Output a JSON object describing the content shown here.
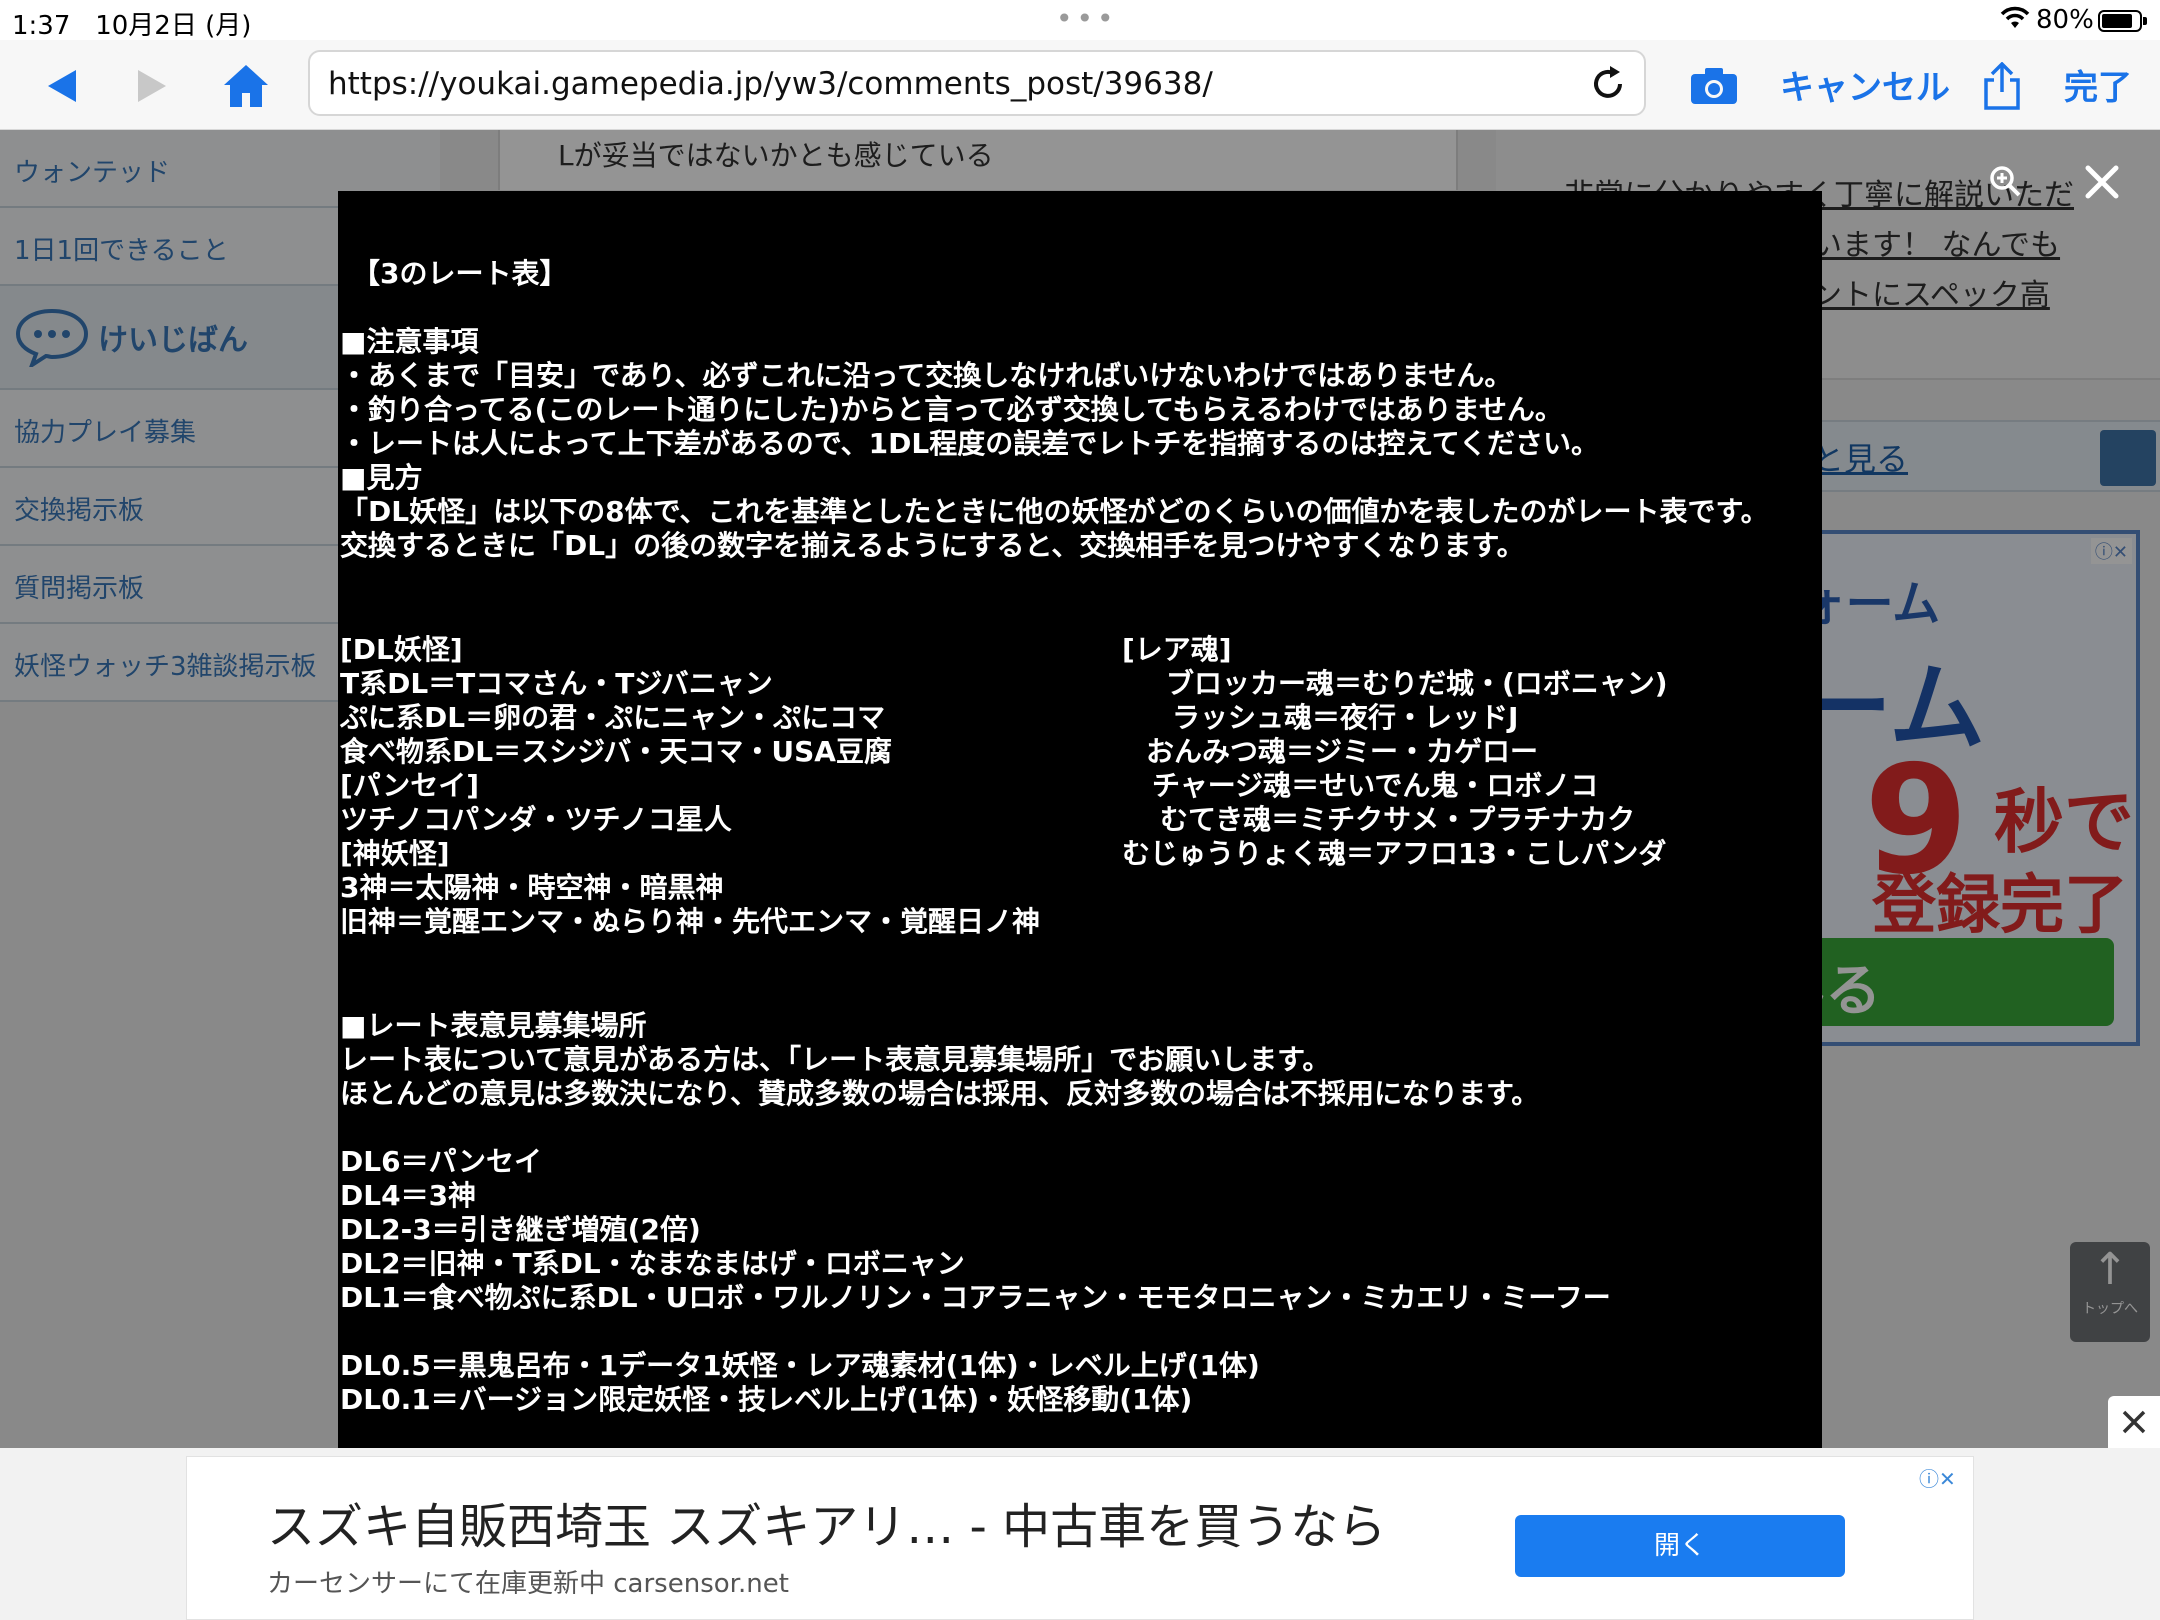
{
  "status_bar": {
    "time": "1:37",
    "date": "10月2日 (月)",
    "battery": "80%",
    "dots": "•••"
  },
  "toolbar": {
    "url": "https://youkai.gamepedia.jp/yw3/comments_post/39638/",
    "cancel_label": "キャンセル",
    "done_label": "完了"
  },
  "sidebar": {
    "items": [
      "ウォンテッド",
      "1日1回できること",
      "けいじばん",
      "協力プレイ募集",
      "交換掲示板",
      "質問掲示板",
      "妖怪ウォッチ3雑談掲示板"
    ]
  },
  "main": {
    "snippet": "Lが妥当ではないかとも感じている"
  },
  "right_panel": {
    "lines": [
      "非常に分かりやすく丁寧に解説いただ",
      "います！ なんでも",
      "ントにスペック高"
    ],
    "more_link": "と見る"
  },
  "side_ad": {
    "line1": "るSSLフォーム",
    "line2": "フォーム",
    "big_num": "9",
    "line3": "秒で",
    "line4": "登録完了!",
    "button": "使ってみる",
    "badge": "ⓘ✕"
  },
  "to_top": {
    "label": "トップへ"
  },
  "lightbox": {
    "title": "【3のレート表】",
    "notes_header": "■注意事項",
    "notes": [
      "・あくまで「目安」であり、必ずこれに沿って交換しなければいけないわけではありません。",
      "・釣り合ってる(このレート通りにした)からと言って必ず交換してもらえるわけではありません。",
      "・レートは人によって上下差があるので、1DL程度の誤差でレトチを指摘するのは控えてください。"
    ],
    "how_header": "■見方",
    "how": [
      "「DL妖怪」は以下の8体で、これを基準としたときに他の妖怪がどのくらいの価値かを表したのがレート表です。",
      "交換するときに「DL」の後の数字を揃えるようにすると、交換相手を見つけやすくなります。"
    ],
    "left_list": [
      "[DL妖怪]",
      "T系DL＝Tコマさん・Tジバニャン",
      "ぷに系DL＝卵の君・ぷにニャン・ぷにコマ",
      "食べ物系DL＝スシジバ・天コマ・USA豆腐",
      "[パンセイ]",
      "ツチノコパンダ・ツチノコ星人",
      "[神妖怪]",
      "3神＝太陽神・時空神・暗黒神",
      "旧神＝覚醒エンマ・ぬらり神・先代エンマ・覚醒日ノ神"
    ],
    "right_list": [
      "[レア魂]",
      "ブロッカー魂＝むりだ城・(ロボニャン)",
      "ラッシュ魂＝夜行・レッドJ",
      "おんみつ魂＝ジミー・カゲロー",
      "チャージ魂＝せいでん鬼・ロボノコ",
      "むてき魂＝ミチクサメ・プラチナカク",
      "むじゅうりょく魂＝アフロ13・こしパンダ"
    ],
    "opinion_header": "■レート表意見募集場所",
    "opinion": [
      "レート表について意見がある方は、「レート表意見募集場所」でお願いします。",
      "ほとんどの意見は多数決になり、賛成多数の場合は採用、反対多数の場合は不採用になります。"
    ],
    "rates_a": [
      "DL6＝パンセイ",
      "DL4＝3神",
      "DL2-3＝引き継ぎ増殖(2倍)",
      "DL2＝旧神・T系DL・なまなまはげ・ロボニャン",
      "DL1＝食べ物ぷに系DL・Uロボ・ワルノリン・コアラニャン・モモタロニャン・ミカエリ・ミーフー"
    ],
    "rates_b": [
      "DL0.5＝黒鬼呂布・1データ1妖怪・レア魂素材(1体)・レベル上げ(1体)",
      "DL0.1＝バージョン限定妖怪・技レベル上げ(1体)・妖怪移動(1体)"
    ]
  },
  "bottom_ad": {
    "title": "スズキ自販西埼玉 スズキアリ… - 中古車を買うなら",
    "subtitle": "カーセンサーにて在庫更新中 carsensor.net",
    "button": "開く",
    "badge": "ⓘ✕"
  }
}
